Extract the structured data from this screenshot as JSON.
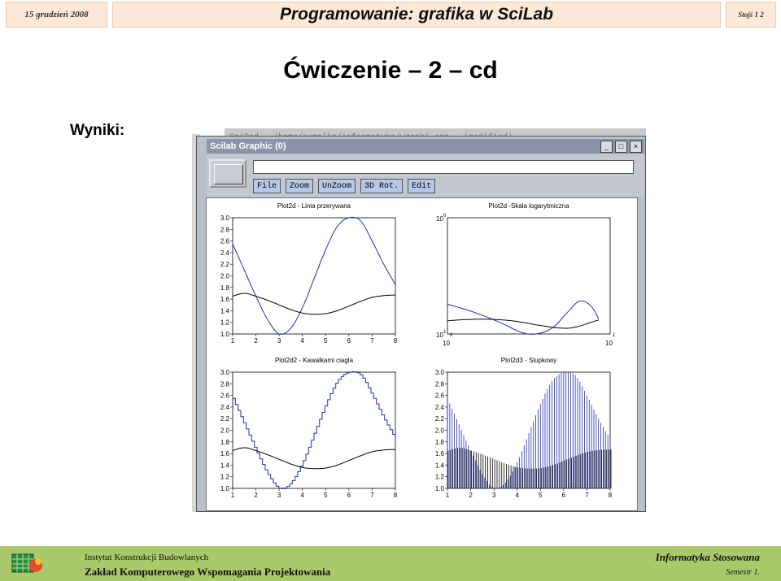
{
  "header": {
    "date": "15 grudzień 2008",
    "title": "Programowanie: grafika w SciLab",
    "page": "Stojś 1 2"
  },
  "slide": {
    "title": "Ćwiczenie – 2 – cd",
    "label": "Wyniki:"
  },
  "window": {
    "background_title": "SciPad - /home/sumelka/informatyka/wzorki.sce - (modified)",
    "title": "Scilab Graphic (0)",
    "menu": [
      "File",
      "Zoom",
      "UnZoom",
      "3D Rot.",
      "Edit"
    ],
    "controls": [
      "_",
      "□",
      "×"
    ]
  },
  "chart_data": [
    {
      "type": "line",
      "title": "Plot2d - Linia przerywana",
      "x_ticks": [
        "1",
        "2",
        "3",
        "4",
        "5",
        "6",
        "7",
        "8"
      ],
      "y_ticks": [
        "1.0",
        "1.2",
        "1.4",
        "1.6",
        "1.8",
        "2.0",
        "2.2",
        "2.4",
        "2.6",
        "2.8",
        "3.0"
      ],
      "xlim": [
        1,
        8
      ],
      "ylim": [
        1.0,
        3.0
      ],
      "series": [
        {
          "color": "#2030b0",
          "x": [
            1,
            1.5,
            2,
            2.5,
            3,
            3.5,
            4,
            4.5,
            5,
            5.5,
            6,
            6.5,
            7,
            7.5,
            8
          ],
          "y": [
            2.55,
            2.1,
            1.65,
            1.25,
            1.0,
            1.1,
            1.45,
            1.95,
            2.45,
            2.85,
            3.0,
            2.95,
            2.6,
            2.2,
            1.85
          ]
        },
        {
          "color": "#000000",
          "x": [
            1,
            1.5,
            2,
            2.5,
            3,
            3.5,
            4,
            4.5,
            5,
            5.5,
            6,
            6.5,
            7,
            7.5,
            8
          ],
          "y": [
            1.65,
            1.7,
            1.65,
            1.58,
            1.5,
            1.42,
            1.36,
            1.34,
            1.35,
            1.4,
            1.48,
            1.56,
            1.63,
            1.66,
            1.67
          ]
        }
      ]
    },
    {
      "type": "line",
      "title": "Plot2d -Skala logarytmiczna",
      "x_tick_labels": [
        "10",
        "10"
      ],
      "x_tick_exponents": [
        "0",
        "1"
      ],
      "y_tick_labels": [
        "10",
        "10"
      ],
      "y_tick_exponents": [
        "0",
        "1"
      ],
      "xlim": [
        1,
        10
      ],
      "ylim": [
        1,
        10
      ],
      "log_axes": true,
      "series": [
        {
          "color": "#2030b0",
          "x": [
            1,
            1.3,
            1.7,
            2.2,
            2.8,
            3.5,
            4.5,
            5.5,
            6.5,
            7.5,
            8.5
          ],
          "y": [
            1.8,
            1.62,
            1.42,
            1.22,
            1.04,
            1.0,
            1.15,
            1.55,
            1.92,
            1.78,
            1.35
          ]
        },
        {
          "color": "#000000",
          "x": [
            1,
            1.3,
            1.7,
            2.2,
            2.8,
            3.5,
            4.5,
            5.5,
            6.5,
            7.5,
            8.5
          ],
          "y": [
            1.3,
            1.33,
            1.34,
            1.32,
            1.27,
            1.2,
            1.14,
            1.12,
            1.17,
            1.25,
            1.32
          ]
        }
      ]
    },
    {
      "type": "line",
      "title": "Plot2d2 - Kawalkami ciagla",
      "x_ticks": [
        "1",
        "2",
        "3",
        "4",
        "5",
        "6",
        "7",
        "8"
      ],
      "y_ticks": [
        "1.0",
        "1.2",
        "1.4",
        "1.6",
        "1.8",
        "2.0",
        "2.2",
        "2.4",
        "2.6",
        "2.8",
        "3.0"
      ],
      "xlim": [
        1,
        8
      ],
      "ylim": [
        1.0,
        3.0
      ],
      "series": [
        {
          "color": "#2030b0",
          "step": true,
          "x": [
            1,
            1.5,
            2,
            2.5,
            3,
            3.5,
            4,
            4.5,
            5,
            5.5,
            6,
            6.5,
            7,
            7.5,
            8
          ],
          "y": [
            2.55,
            2.1,
            1.65,
            1.25,
            1.0,
            1.1,
            1.45,
            1.95,
            2.45,
            2.85,
            3.0,
            2.95,
            2.6,
            2.2,
            1.85
          ]
        },
        {
          "color": "#000000",
          "x": [
            1,
            1.5,
            2,
            2.5,
            3,
            3.5,
            4,
            4.5,
            5,
            5.5,
            6,
            6.5,
            7,
            7.5,
            8
          ],
          "y": [
            1.65,
            1.7,
            1.65,
            1.58,
            1.5,
            1.42,
            1.36,
            1.34,
            1.35,
            1.4,
            1.48,
            1.56,
            1.63,
            1.66,
            1.67
          ]
        }
      ]
    },
    {
      "type": "bar",
      "title": "Plot2d3 - Slupkowy",
      "x_ticks": [
        "1",
        "2",
        "3",
        "4",
        "5",
        "6",
        "7",
        "8"
      ],
      "y_ticks": [
        "1.0",
        "1.2",
        "1.4",
        "1.6",
        "1.8",
        "2.0",
        "2.2",
        "2.4",
        "2.6",
        "2.8",
        "3.0"
      ],
      "xlim": [
        1,
        8
      ],
      "ylim": [
        1.0,
        3.0
      ],
      "series": [
        {
          "color": "#2030b0",
          "x": [
            1,
            1.5,
            2,
            2.5,
            3,
            3.5,
            4,
            4.5,
            5,
            5.5,
            6,
            6.5,
            7,
            7.5,
            8
          ],
          "y": [
            2.55,
            2.1,
            1.65,
            1.25,
            1.0,
            1.1,
            1.45,
            1.95,
            2.45,
            2.85,
            3.0,
            2.95,
            2.6,
            2.2,
            1.85
          ]
        },
        {
          "color": "#000000",
          "x": [
            1,
            1.5,
            2,
            2.5,
            3,
            3.5,
            4,
            4.5,
            5,
            5.5,
            6,
            6.5,
            7,
            7.5,
            8
          ],
          "y": [
            1.65,
            1.7,
            1.65,
            1.58,
            1.5,
            1.42,
            1.36,
            1.34,
            1.35,
            1.4,
            1.48,
            1.56,
            1.63,
            1.66,
            1.67
          ]
        }
      ]
    }
  ],
  "footer": {
    "institute": "Instytut Konstrukcji Budowlanych",
    "department": "Zakład Komputerowego Wspomagania Projektowania",
    "course": "Informatyka Stosowana",
    "semester": "Semestr 1."
  },
  "colors": {
    "header_bg": "#fde9d9",
    "footer_bg": "#a9c96b",
    "plot_blue": "#2030b0"
  }
}
